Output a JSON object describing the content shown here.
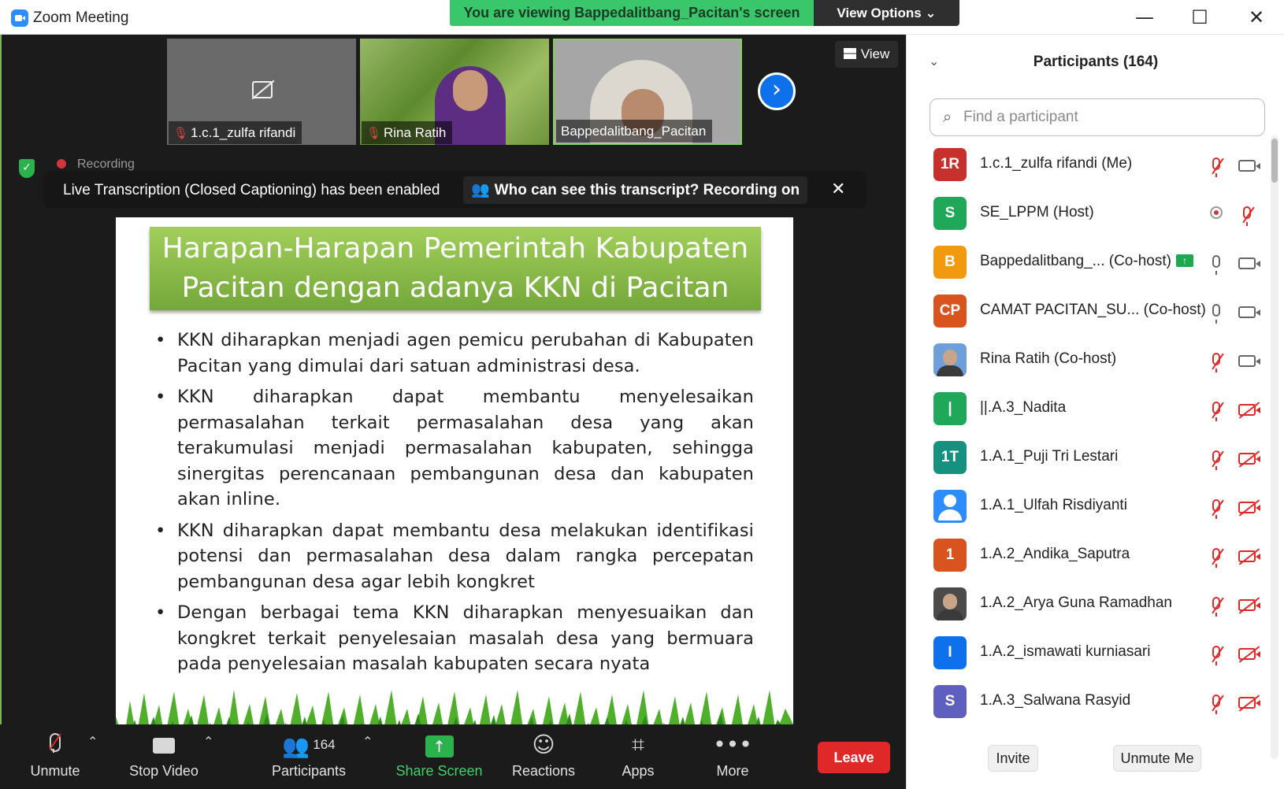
{
  "window": {
    "title": "Zoom Meeting",
    "minimize_glyph": "—",
    "maximize_glyph": "☐",
    "close_glyph": "✕"
  },
  "banner": {
    "viewing_text": "You are viewing Bappedalitbang_Pacitan's screen",
    "view_options_label": "View Options ⌄"
  },
  "thumbnails": [
    {
      "name": "1.c.1_zulfa rifandi",
      "muted": true,
      "video": false
    },
    {
      "name": "Rina Ratih",
      "muted": true,
      "video": true
    },
    {
      "name": "Bappedalitbang_Pacitan",
      "muted": false,
      "video": true,
      "active_speaker": true
    }
  ],
  "view_button": {
    "label": "View"
  },
  "recording": {
    "label": "Recording"
  },
  "caption_bar": {
    "text": "Live Transcription (Closed Captioning) has been enabled",
    "who_text": "Who can see this transcript? Recording on",
    "close_glyph": "✕"
  },
  "slide": {
    "title_line1": "Harapan-Harapan Pemerintah Kabupaten",
    "title_line2": "Pacitan dengan adanya KKN di Pacitan",
    "bullets": [
      "KKN diharapkan menjadi agen pemicu perubahan di Kabupaten Pacitan yang dimulai dari satuan administrasi desa.",
      "KKN diharapkan dapat membantu menyelesaikan permasalahan terkait permasalahan desa yang akan terakumulasi menjadi permasalahan kabupaten, sehingga sinergitas perencanaan pembangunan desa dan kabupaten akan inline.",
      "KKN diharapkan dapat membantu desa melakukan identifikasi potensi dan permasalahan desa dalam rangka percepatan pembangunan desa agar lebih kongkret",
      "Dengan berbagai tema KKN diharapkan menyesuaikan dan kongkret terkait penyelesaian masalah desa yang bermuara pada penyelesaian masalah kabupaten secara nyata"
    ]
  },
  "toolbar": {
    "unmute": "Unmute",
    "stop_video": "Stop Video",
    "participants": "Participants",
    "participants_count": "164",
    "share_screen": "Share Screen",
    "reactions": "Reactions",
    "apps": "Apps",
    "more": "More",
    "leave": "Leave"
  },
  "panel": {
    "title": "Participants (164)",
    "search_placeholder": "Find a participant",
    "invite": "Invite",
    "unmute_me": "Unmute Me",
    "participants": [
      {
        "initials": "1R",
        "color": "#c8312b",
        "name": "1.c.1_zulfa rifandi (Me)",
        "mic": "off",
        "cam": "on"
      },
      {
        "initials": "S",
        "color": "#1fa85a",
        "name": "SE_LPPM (Host)",
        "mic": "off",
        "cam": "record"
      },
      {
        "initials": "B",
        "color": "#f29a0f",
        "name": "Bappedalitbang_...  (Co-host)",
        "mic": "on",
        "cam": "on",
        "sharing": true
      },
      {
        "initials": "CP",
        "color": "#d9531e",
        "name": "CAMAT PACITAN_SU...  (Co-host)",
        "mic": "on",
        "cam": "on"
      },
      {
        "initials": "",
        "color": "#6f9fd8",
        "name": "Rina Ratih (Co-host)",
        "mic": "off",
        "cam": "on",
        "photo": true
      },
      {
        "initials": "|",
        "color": "#1fa85a",
        "name": "||.A.3_Nadita",
        "mic": "off",
        "cam": "off"
      },
      {
        "initials": "1T",
        "color": "#16907f",
        "name": "1.A.1_Puji Tri Lestari",
        "mic": "off",
        "cam": "off"
      },
      {
        "initials": "",
        "color": "#2d8cff",
        "name": "1.A.1_Ulfah Risdiyanti",
        "mic": "off",
        "cam": "off",
        "default_avatar": true
      },
      {
        "initials": "1",
        "color": "#d9531e",
        "name": "1.A.2_Andika_Saputra",
        "mic": "off",
        "cam": "off"
      },
      {
        "initials": "",
        "color": "#4b4b4b",
        "name": "1.A.2_Arya Guna Ramadhan",
        "mic": "off",
        "cam": "off",
        "photo": true
      },
      {
        "initials": "I",
        "color": "#0e71eb",
        "name": "1.A.2_ismawati kurniasari",
        "mic": "off",
        "cam": "off"
      },
      {
        "initials": "S",
        "color": "#5f5fc0",
        "name": "1.A.3_Salwana Rasyid",
        "mic": "off",
        "cam": "off"
      }
    ]
  }
}
